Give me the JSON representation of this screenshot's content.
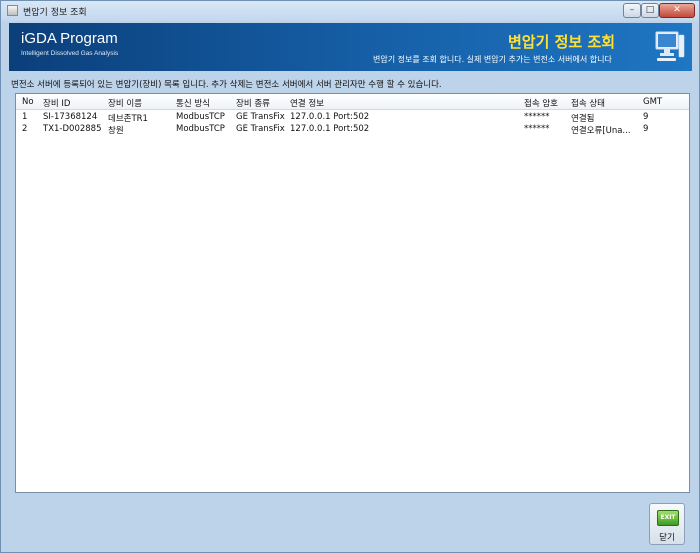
{
  "window": {
    "title": "변압기 정보 조회"
  },
  "banner": {
    "brand": "iGDA Program",
    "brand_sub": "Intelligent Dissolved Gas Analysis",
    "title": "변압기 정보 조회",
    "description": "변압기 정보를 조회 합니다. 실제 변압기 추가는 변전소 서버에서 합니다"
  },
  "notice": "변전소 서버에 등록되어 있는 변압기(장비) 목록 입니다. 추가 삭제는 변전소 서버에서 서버 관리자만 수행 할 수 있습니다.",
  "table": {
    "columns": [
      "No",
      "장비 ID",
      "장비 이름",
      "통신 방식",
      "장비 종류",
      "연결 정보",
      "접속 암호",
      "접속 상태",
      "GMT"
    ],
    "rows": [
      [
        "1",
        "SI-17368124",
        "데브존TR1",
        "ModbusTCP",
        "GE TransFix",
        "127.0.0.1 Port:502",
        "******",
        "연결됨",
        "9"
      ],
      [
        "2",
        "TX1-D002885",
        "창원",
        "ModbusTCP",
        "GE TransFix",
        "127.0.0.1 Port:502",
        "******",
        "연결오류[Una...",
        "9"
      ]
    ]
  },
  "footer": {
    "exit_icon_text": "EXIT",
    "close_label": "닫기"
  },
  "icons": {
    "app": "window-app-icon",
    "monitor": "monitor-icon",
    "exit": "exit-icon"
  },
  "colors": {
    "banner": "#1660a8",
    "banner_title": "#ffe135",
    "window_bg": "#bcd3ea"
  }
}
